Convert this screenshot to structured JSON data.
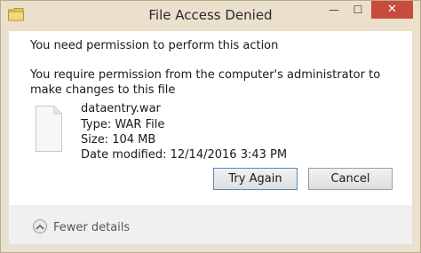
{
  "window": {
    "title": "File Access Denied",
    "controls": {
      "minimize": "—",
      "maximize": "☐",
      "close": "✕"
    }
  },
  "message": {
    "primary": "You need permission to perform this action",
    "secondary": "You require permission from the computer's administrator to make changes to this file"
  },
  "file": {
    "name": "dataentry.war",
    "type": "Type: WAR File",
    "size": "Size: 104 MB",
    "date_modified": "Date modified: 12/14/2016 3:43 PM"
  },
  "buttons": {
    "try_again": "Try Again",
    "cancel": "Cancel"
  },
  "footer": {
    "fewer_details": "Fewer details"
  },
  "colors": {
    "title_bar": "#eae0cb",
    "close_button": "#c74c3c",
    "default_button_border": "#5b84c4"
  },
  "icons": {
    "title": "folder-icon",
    "file": "file-icon",
    "details": "chevron-up-icon"
  }
}
